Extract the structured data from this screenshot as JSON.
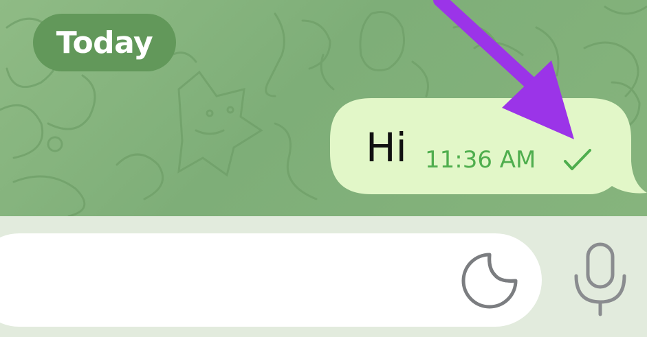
{
  "chat": {
    "date_label": "Today",
    "messages": [
      {
        "direction": "outgoing",
        "text": "Hi",
        "time": "11:36 AM",
        "status": "sent-check-icon"
      }
    ]
  },
  "composer": {
    "placeholder": "",
    "sticker_icon": "sticker-icon",
    "mic_icon": "microphone-icon"
  },
  "colors": {
    "chat_background": "#86b47d",
    "date_pill": "#62985a",
    "outgoing_bubble": "#e2f7c8",
    "timestamp": "#4fae4e",
    "annotation_arrow": "#9b34e8"
  }
}
